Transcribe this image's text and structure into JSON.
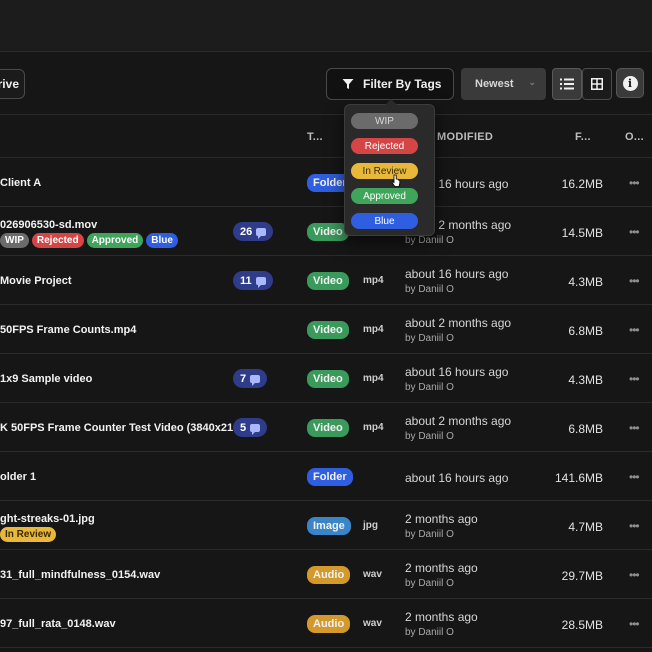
{
  "toolbar": {
    "drive_label": "rive",
    "filter_label": "Filter By Tags",
    "sort_value": "Newest"
  },
  "icons": {
    "filter": "filter-icon",
    "list_view": "list-view-icon",
    "grid_view": "grid-view-icon",
    "info": "info-icon",
    "comment": "comment-icon",
    "more": "more-icon"
  },
  "table": {
    "headers": {
      "type": "T...",
      "modified": "MODIFIED",
      "size": "F...",
      "owner": "O..."
    }
  },
  "tag_filter": {
    "options": [
      {
        "label": "WIP",
        "color": "#6b6b6b"
      },
      {
        "label": "Rejected",
        "color": "#d64545"
      },
      {
        "label": "In Review",
        "color": "#e7b83a"
      },
      {
        "label": "Approved",
        "color": "#3fa55a"
      },
      {
        "label": "Blue",
        "color": "#2f5fe0"
      }
    ]
  },
  "rows": [
    {
      "name": "Client A",
      "type": "Folder",
      "ext": "",
      "modified": "about 16 hours ago",
      "by": "",
      "size": "16.2MB",
      "comments": "",
      "tags": []
    },
    {
      "name": "026906530-sd.mov",
      "type": "Video",
      "ext": "",
      "modified": "about 2 months ago",
      "by": "by Daniil O",
      "size": "14.5MB",
      "comments": "26",
      "tags": [
        "WIP",
        "Rejected",
        "Approved",
        "Blue"
      ]
    },
    {
      "name": "Movie Project",
      "type": "Video",
      "ext": "mp4",
      "modified": "about 16 hours ago",
      "by": "by Daniil O",
      "size": "4.3MB",
      "comments": "11",
      "tags": []
    },
    {
      "name": "50FPS Frame Counts.mp4",
      "type": "Video",
      "ext": "mp4",
      "modified": "about 2 months ago",
      "by": "by Daniil O",
      "size": "6.8MB",
      "comments": "",
      "tags": []
    },
    {
      "name": "1x9 Sample video",
      "type": "Video",
      "ext": "mp4",
      "modified": "about 16 hours ago",
      "by": "by Daniil O",
      "size": "4.3MB",
      "comments": "7",
      "tags": []
    },
    {
      "name": "K 50FPS Frame Counter Test Video (3840x21...",
      "type": "Video",
      "ext": "mp4",
      "modified": "about 2 months ago",
      "by": "by Daniil O",
      "size": "6.8MB",
      "comments": "5",
      "tags": []
    },
    {
      "name": "older 1",
      "type": "Folder",
      "ext": "",
      "modified": "about 16 hours ago",
      "by": "",
      "size": "141.6MB",
      "comments": "",
      "tags": []
    },
    {
      "name": "ght-streaks-01.jpg",
      "type": "Image",
      "ext": "jpg",
      "modified": "2 months ago",
      "by": "by Daniil O",
      "size": "4.7MB",
      "comments": "",
      "tags": [
        "In Review"
      ]
    },
    {
      "name": "31_full_mindfulness_0154.wav",
      "type": "Audio",
      "ext": "wav",
      "modified": "2 months ago",
      "by": "by Daniil O",
      "size": "29.7MB",
      "comments": "",
      "tags": []
    },
    {
      "name": "97_full_rata_0148.wav",
      "type": "Audio",
      "ext": "wav",
      "modified": "2 months ago",
      "by": "by Daniil O",
      "size": "28.5MB",
      "comments": "",
      "tags": []
    }
  ],
  "colors": {
    "Folder": "#2f5fe0",
    "Video": "#3a9a5c",
    "Image": "#3a85c8",
    "Audio": "#d4992c",
    "tag_WIP": "#6b6b6b",
    "tag_Rejected": "#d64545",
    "tag_In Review": "#e7b83a",
    "tag_Approved": "#3fa55a",
    "tag_Blue": "#2f5fe0"
  }
}
